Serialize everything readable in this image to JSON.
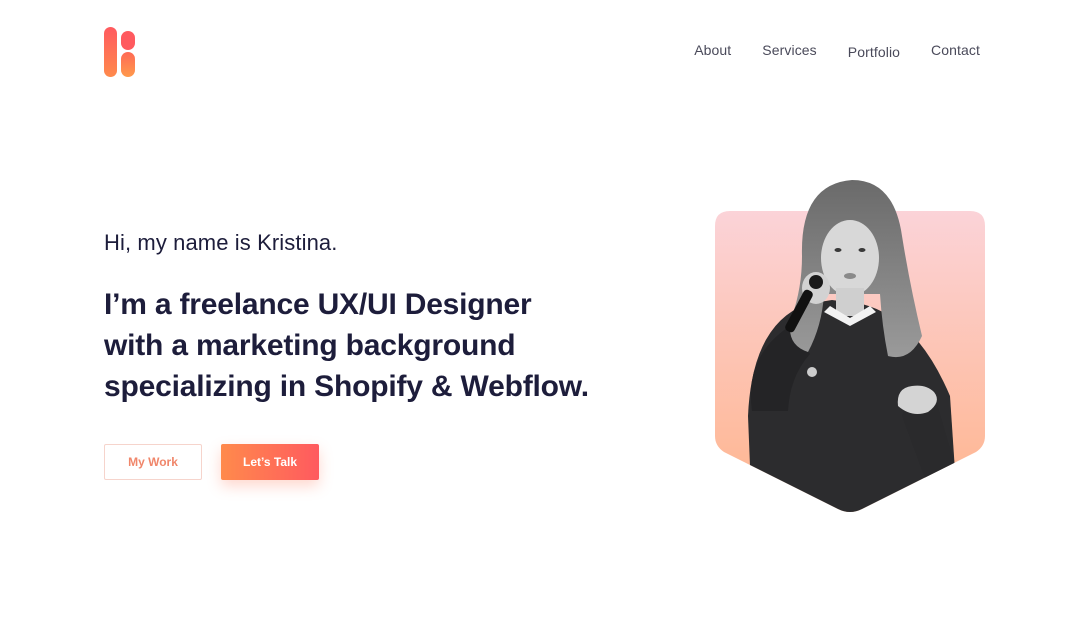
{
  "brand": {
    "logo_icon": "k-letter-logo-icon",
    "accent_start": "#ff5a5f",
    "accent_end": "#ff8a4c"
  },
  "nav": {
    "items": [
      {
        "label": "About"
      },
      {
        "label": "Services"
      },
      {
        "label": "Portfolio"
      },
      {
        "label": "Contact"
      }
    ]
  },
  "hero": {
    "greeting": "Hi, my name is Kristina.",
    "headline_lines": [
      "I’m a freelance UX/UI Designer",
      "with a marketing background",
      "specializing in Shopify & Webflow."
    ],
    "buttons": {
      "my_work": "My Work",
      "lets_talk": "Let’s Talk"
    },
    "photo_icon": "portrait-photo",
    "photo_bg_top": "#fbd3d8",
    "photo_bg_bottom": "#ffb48c"
  }
}
